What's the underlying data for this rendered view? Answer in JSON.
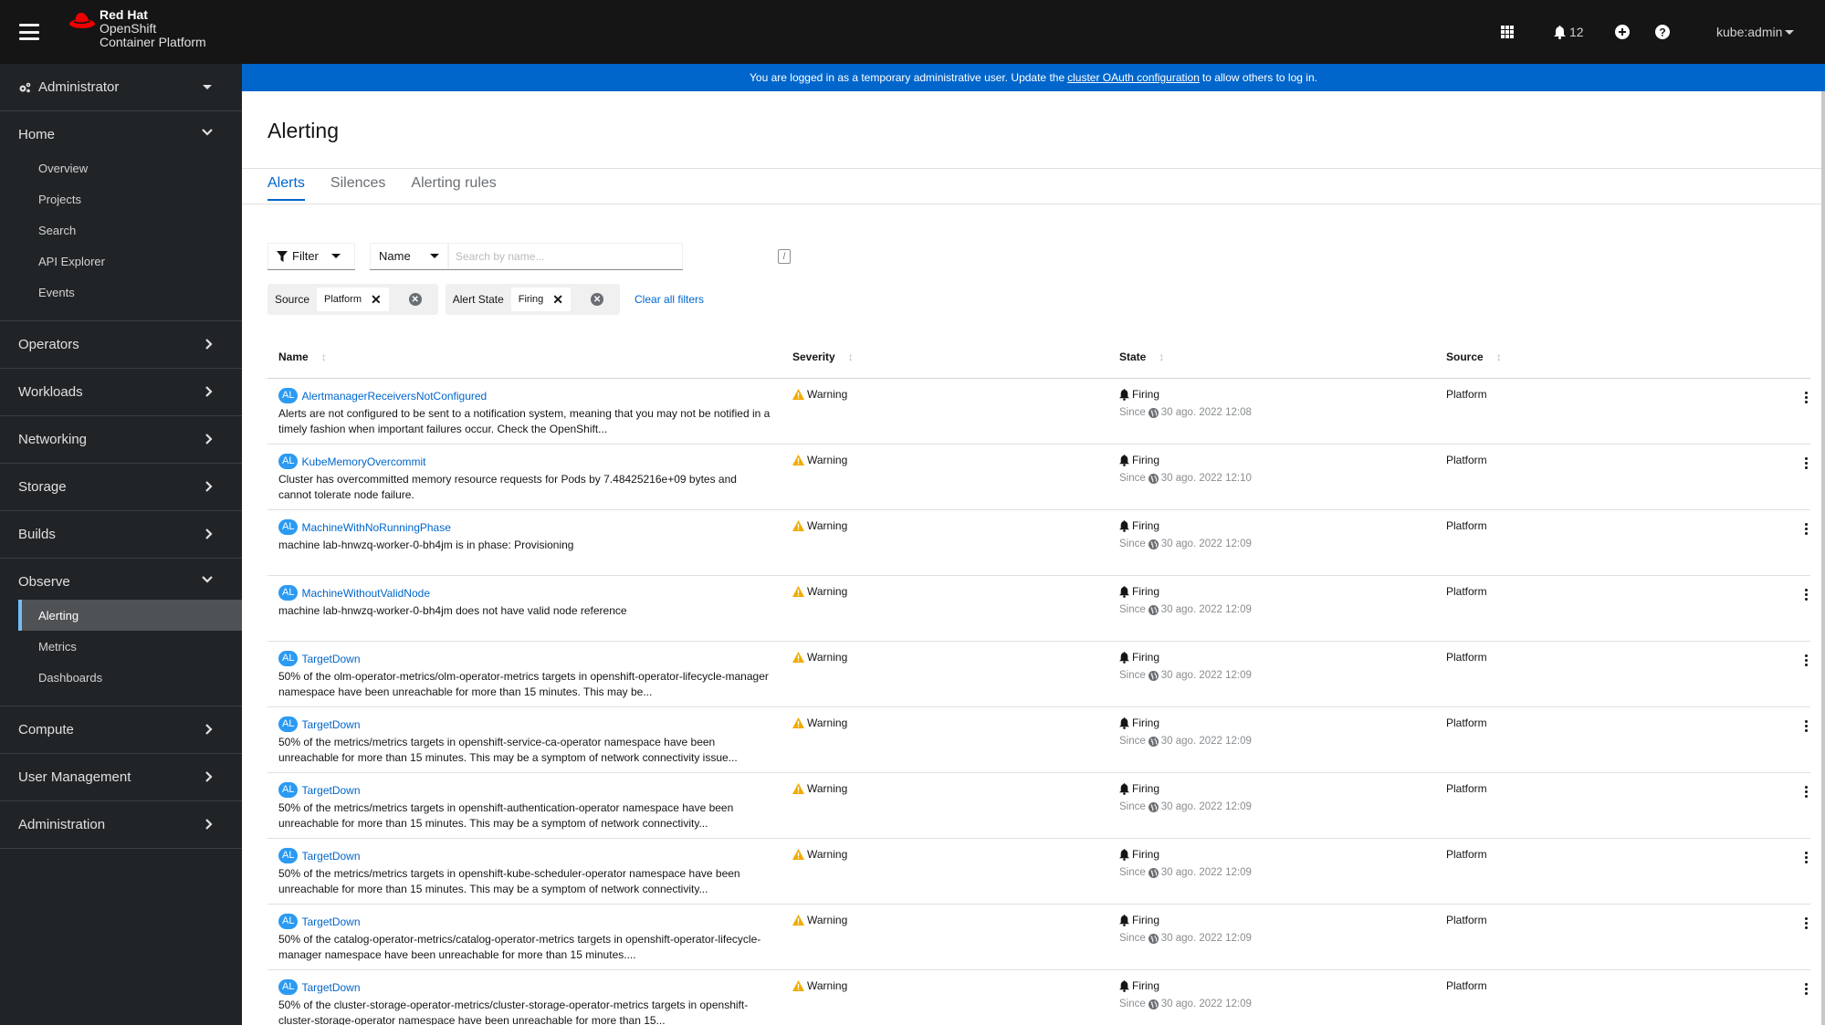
{
  "masthead": {
    "brand_line1": "Red Hat",
    "brand_line2": "OpenShift",
    "brand_line3": "Container Platform",
    "notifications_count": "12",
    "user": "kube:admin"
  },
  "banner": {
    "text_before": "You are logged in as a temporary administrative user. Update the",
    "link": "cluster OAuth configuration",
    "text_after": "to allow others to log in."
  },
  "sidebar": {
    "perspective": "Administrator",
    "sections": [
      {
        "label": "Home",
        "expanded": true,
        "items": [
          "Overview",
          "Projects",
          "Search",
          "API Explorer",
          "Events"
        ]
      },
      {
        "label": "Operators",
        "expanded": false
      },
      {
        "label": "Workloads",
        "expanded": false
      },
      {
        "label": "Networking",
        "expanded": false
      },
      {
        "label": "Storage",
        "expanded": false
      },
      {
        "label": "Builds",
        "expanded": false
      },
      {
        "label": "Observe",
        "expanded": true,
        "items": [
          "Alerting",
          "Metrics",
          "Dashboards"
        ],
        "active_item": "Alerting"
      },
      {
        "label": "Compute",
        "expanded": false
      },
      {
        "label": "User Management",
        "expanded": false
      },
      {
        "label": "Administration",
        "expanded": false
      }
    ]
  },
  "page": {
    "title": "Alerting",
    "tabs": [
      "Alerts",
      "Silences",
      "Alerting rules"
    ],
    "active_tab": "Alerts"
  },
  "toolbar": {
    "filter_label": "Filter",
    "name_select": "Name",
    "search_placeholder": "Search by name...",
    "shortcut": "/",
    "chip_groups": [
      {
        "category": "Source",
        "chips": [
          "Platform"
        ]
      },
      {
        "category": "Alert State",
        "chips": [
          "Firing"
        ]
      }
    ],
    "clear_all": "Clear all filters"
  },
  "table": {
    "columns": [
      "Name",
      "Severity",
      "State",
      "Source"
    ],
    "rows": [
      {
        "badge": "AL",
        "name": "AlertmanagerReceiversNotConfigured",
        "desc": "Alerts are not configured to be sent to a notification system, meaning that you may not be notified in a timely fashion when important failures occur. Check the OpenShift...",
        "severity": "Warning",
        "state": "Firing",
        "since_label": "Since",
        "since": "30 ago. 2022 12:08",
        "source": "Platform"
      },
      {
        "badge": "AL",
        "name": "KubeMemoryOvercommit",
        "desc": "Cluster has overcommitted memory resource requests for Pods by 7.48425216e+09 bytes and cannot tolerate node failure.",
        "severity": "Warning",
        "state": "Firing",
        "since_label": "Since",
        "since": "30 ago. 2022 12:10",
        "source": "Platform"
      },
      {
        "badge": "AL",
        "name": "MachineWithNoRunningPhase",
        "desc": "machine lab-hnwzq-worker-0-bh4jm is in phase: Provisioning",
        "severity": "Warning",
        "state": "Firing",
        "since_label": "Since",
        "since": "30 ago. 2022 12:09",
        "source": "Platform"
      },
      {
        "badge": "AL",
        "name": "MachineWithoutValidNode",
        "desc": "machine lab-hnwzq-worker-0-bh4jm does not have valid node reference",
        "severity": "Warning",
        "state": "Firing",
        "since_label": "Since",
        "since": "30 ago. 2022 12:09",
        "source": "Platform"
      },
      {
        "badge": "AL",
        "name": "TargetDown",
        "desc": "50% of the olm-operator-metrics/olm-operator-metrics targets in openshift-operator-lifecycle-manager namespace have been unreachable for more than 15 minutes. This may be...",
        "severity": "Warning",
        "state": "Firing",
        "since_label": "Since",
        "since": "30 ago. 2022 12:09",
        "source": "Platform"
      },
      {
        "badge": "AL",
        "name": "TargetDown",
        "desc": "50% of the metrics/metrics targets in openshift-service-ca-operator namespace have been unreachable for more than 15 minutes. This may be a symptom of network connectivity issue...",
        "severity": "Warning",
        "state": "Firing",
        "since_label": "Since",
        "since": "30 ago. 2022 12:09",
        "source": "Platform"
      },
      {
        "badge": "AL",
        "name": "TargetDown",
        "desc": "50% of the metrics/metrics targets in openshift-authentication-operator namespace have been unreachable for more than 15 minutes. This may be a symptom of network connectivity...",
        "severity": "Warning",
        "state": "Firing",
        "since_label": "Since",
        "since": "30 ago. 2022 12:09",
        "source": "Platform"
      },
      {
        "badge": "AL",
        "name": "TargetDown",
        "desc": "50% of the metrics/metrics targets in openshift-kube-scheduler-operator namespace have been unreachable for more than 15 minutes. This may be a symptom of network connectivity...",
        "severity": "Warning",
        "state": "Firing",
        "since_label": "Since",
        "since": "30 ago. 2022 12:09",
        "source": "Platform"
      },
      {
        "badge": "AL",
        "name": "TargetDown",
        "desc": "50% of the catalog-operator-metrics/catalog-operator-metrics targets in openshift-operator-lifecycle-manager namespace have been unreachable for more than 15 minutes....",
        "severity": "Warning",
        "state": "Firing",
        "since_label": "Since",
        "since": "30 ago. 2022 12:09",
        "source": "Platform"
      },
      {
        "badge": "AL",
        "name": "TargetDown",
        "desc": "50% of the cluster-storage-operator-metrics/cluster-storage-operator-metrics targets in openshift-cluster-storage-operator namespace have been unreachable for more than 15...",
        "severity": "Warning",
        "state": "Firing",
        "since_label": "Since",
        "since": "30 ago. 2022 12:09",
        "source": "Platform"
      }
    ]
  },
  "colors": {
    "accent": "#0066cc",
    "badge": "#2b9af3",
    "warning": "#f0ab00",
    "masthead": "#151515",
    "sidebar": "#212427",
    "active_indicator": "#73bcf7"
  }
}
